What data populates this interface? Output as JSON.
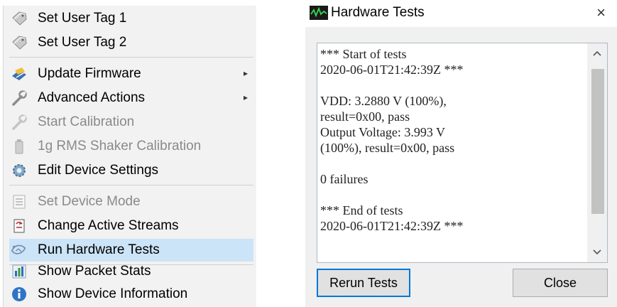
{
  "menu": {
    "items": [
      {
        "label": "Set User Tag 1",
        "icon": "tag-icon",
        "disabled": false
      },
      {
        "label": "Set User Tag 2",
        "icon": "tag-icon",
        "disabled": false
      },
      {
        "label": "Update Firmware",
        "icon": "firmware-icon",
        "disabled": false,
        "submenu": true
      },
      {
        "label": "Advanced Actions",
        "icon": "wrench-icon",
        "disabled": false,
        "submenu": true
      },
      {
        "label": "Start Calibration",
        "icon": "wrench-icon",
        "disabled": true
      },
      {
        "label": "1g RMS Shaker Calibration",
        "icon": "battery-icon",
        "disabled": true
      },
      {
        "label": "Edit Device Settings",
        "icon": "gear-icon",
        "disabled": false
      },
      {
        "label": "Set Device Mode",
        "icon": "list-icon",
        "disabled": true
      },
      {
        "label": "Change Active Streams",
        "icon": "streams-icon",
        "disabled": false
      },
      {
        "label": "Run Hardware Tests",
        "icon": "test-icon",
        "disabled": false,
        "selected": true
      },
      {
        "label": "Show Packet Stats",
        "icon": "bar-chart-icon",
        "disabled": false
      },
      {
        "label": "Show Device Information",
        "icon": "info-icon",
        "disabled": false
      }
    ],
    "submenu_arrow": "▸"
  },
  "dialog": {
    "title": "Hardware Tests",
    "close_glyph": "×",
    "log_lines": [
      "*** Start of tests",
      "2020-06-01T21:42:39Z ***",
      "",
      "VDD: 3.2880 V (100%),",
      "result=0x00, pass",
      "Output Voltage: 3.993 V",
      "(100%), result=0x00, pass",
      "",
      "0 failures",
      "",
      "*** End of tests",
      "2020-06-01T21:42:39Z ***"
    ],
    "rerun_label": "Rerun Tests",
    "close_label": "Close"
  },
  "colors": {
    "menu_background": "#f2f2f2",
    "selected_highlight": "#cce4f7",
    "disabled_text": "#8a8a8a",
    "default_button_border": "#0078d7"
  }
}
